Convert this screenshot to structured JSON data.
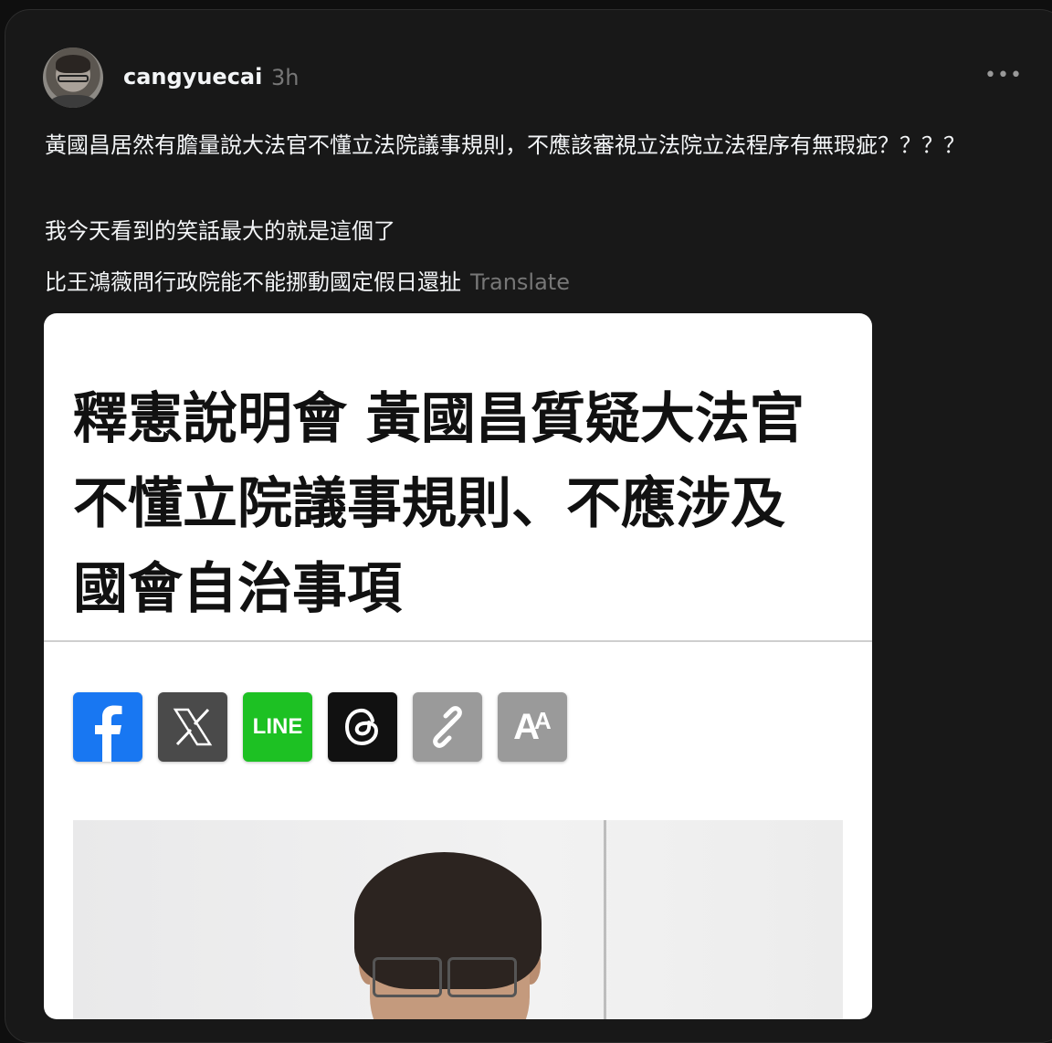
{
  "post": {
    "username": "cangyuecai",
    "time": "3h",
    "more_label": "•••",
    "line1": "黃國昌居然有膽量說大法官不懂立法院議事規則，不應該審視立法院立法程序有無瑕疵？？？？",
    "line2": "我今天看到的笑話最大的就是這個了",
    "line3": "比王鴻薇問行政院能不能挪動國定假日還扯",
    "translate_label": "Translate"
  },
  "article": {
    "headline_line1": "釋憲說明會 黃國昌質疑大法官",
    "headline_line2": "不懂立院議事規則、不應涉及",
    "headline_line3": "國會自治事項",
    "share_buttons": [
      {
        "name": "facebook",
        "icon": "facebook-icon",
        "color": "#1877f2"
      },
      {
        "name": "x",
        "icon": "x-icon",
        "color": "#4a4a4a"
      },
      {
        "name": "line",
        "icon": "line-icon",
        "label": "LINE",
        "color": "#1dc123"
      },
      {
        "name": "threads",
        "icon": "threads-icon",
        "color": "#111111"
      },
      {
        "name": "copy-link",
        "icon": "link-icon",
        "color": "#9a9a9a"
      },
      {
        "name": "font-size",
        "icon": "font-size-icon",
        "label": "AA",
        "color": "#9a9a9a"
      }
    ]
  }
}
